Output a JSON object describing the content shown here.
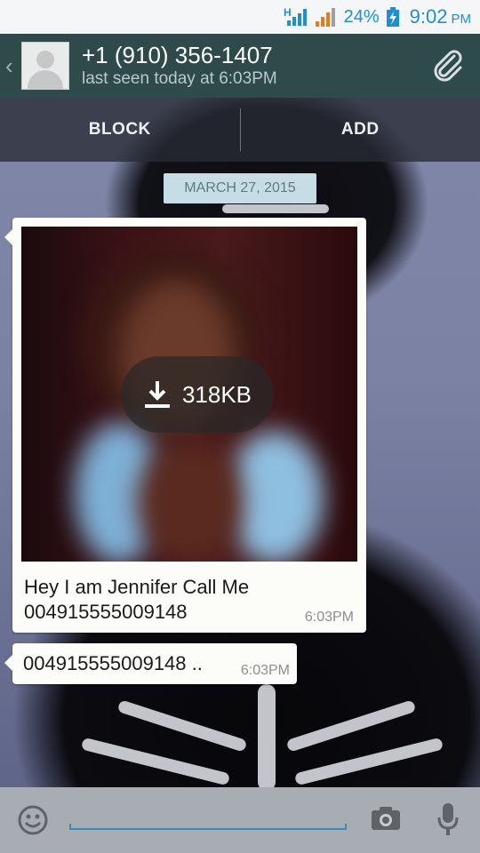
{
  "status_bar": {
    "network_type": "H",
    "battery_percent": "24%",
    "time": "9:02",
    "ampm": "PM",
    "icons": [
      "network-h-icon",
      "signal-icon",
      "battery-charging-icon"
    ]
  },
  "header": {
    "contact_name": "+1 (910) 356-1407",
    "last_seen": "last seen today at 6:03PM",
    "icons": [
      "back-chevron-icon",
      "default-avatar-icon",
      "paperclip-icon"
    ]
  },
  "actions": {
    "block_label": "BLOCK",
    "add_label": "ADD"
  },
  "chat": {
    "date": "MARCH 27, 2015",
    "messages": [
      {
        "type": "image",
        "download_size": "318KB",
        "caption_line1": "Hey I am Jennifer Call Me",
        "caption_line2": "004915555009148",
        "time": "6:03PM"
      },
      {
        "type": "text",
        "text": "004915555009148 ..",
        "time": "6:03PM"
      }
    ]
  },
  "input_bar": {
    "message_value": "",
    "icons": [
      "emoji-icon",
      "camera-icon",
      "microphone-icon"
    ]
  },
  "colors": {
    "header_bg": "#2f4a4b",
    "status_accent": "#1e8fd6",
    "bubble_bg": "#fcfcf8",
    "date_chip_bg": "#c7dde5",
    "input_underline": "#2f8fb8"
  }
}
